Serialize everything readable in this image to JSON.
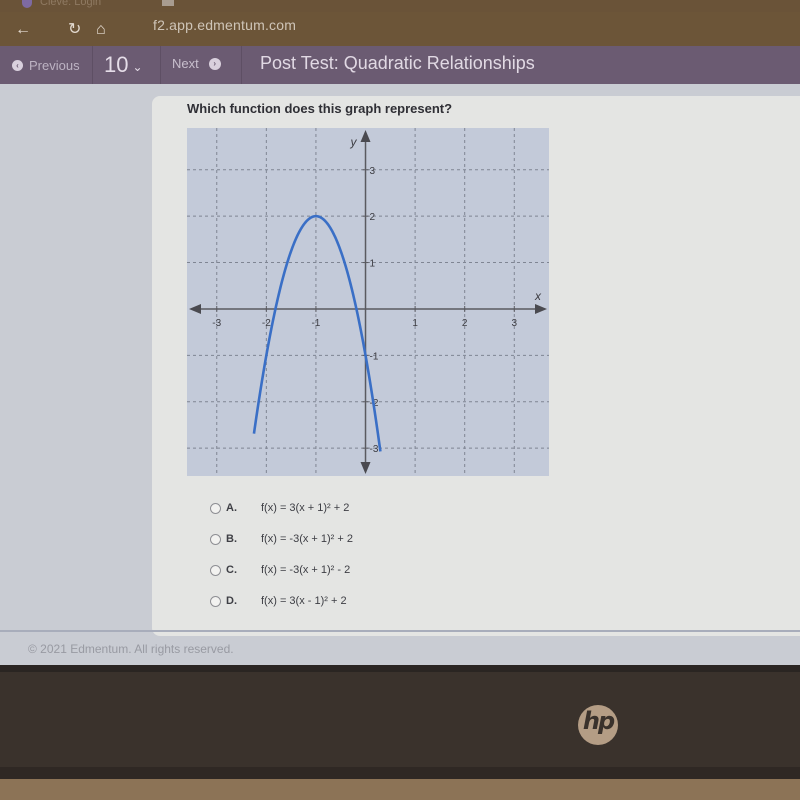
{
  "browser": {
    "tab_title": "Cleve: Login",
    "url": "f2.app.edmentum.com",
    "icons": {
      "back": "arrow-left-icon",
      "reload": "reload-icon",
      "home": "home-icon"
    }
  },
  "toolbar": {
    "previous_label": "Previous",
    "question_number": "10",
    "next_label": "Next",
    "test_title": "Post Test: Quadratic Relationships",
    "icons": {
      "previous": "arrow-circle-left-icon",
      "number_dropdown": "chevron-down-icon",
      "next": "arrow-circle-right-icon"
    }
  },
  "question": {
    "prompt": "Which function does this graph represent?",
    "answers": [
      {
        "letter": "A.",
        "formula": "f(x) = 3(x + 1)² + 2",
        "selected": false
      },
      {
        "letter": "B.",
        "formula": "f(x) = -3(x + 1)² + 2",
        "selected": false
      },
      {
        "letter": "C.",
        "formula": "f(x) = -3(x + 1)² - 2",
        "selected": false
      },
      {
        "letter": "D.",
        "formula": "f(x) = 3(x - 1)² + 2",
        "selected": false
      }
    ]
  },
  "footer": {
    "copyright": "© 2021 Edmentum. All rights reserved."
  },
  "hardware": {
    "logo_text": "hp"
  },
  "chart_data": {
    "type": "line",
    "title": "",
    "xlabel": "x",
    "ylabel": "y",
    "xlim": [
      -3.6,
      3.7
    ],
    "ylim": [
      -3.6,
      3.9
    ],
    "x_ticks": [
      -3,
      -2,
      -1,
      1,
      2,
      3
    ],
    "y_ticks": [
      3,
      2,
      1,
      -1,
      -2,
      -3
    ],
    "grid": true,
    "series": [
      {
        "name": "parabola",
        "function": "-3(x+1)^2+2",
        "vertex": [
          -1,
          2
        ],
        "a": -3,
        "h": -1,
        "k": 2,
        "color": "#3a6fc6",
        "x_range": [
          -2.25,
          0.3
        ]
      }
    ]
  },
  "colors": {
    "toolbar": "#6b5b72",
    "graph_bg": "#bfc8d8",
    "curve": "#3a6fc6",
    "axis": "#5a5a60"
  }
}
